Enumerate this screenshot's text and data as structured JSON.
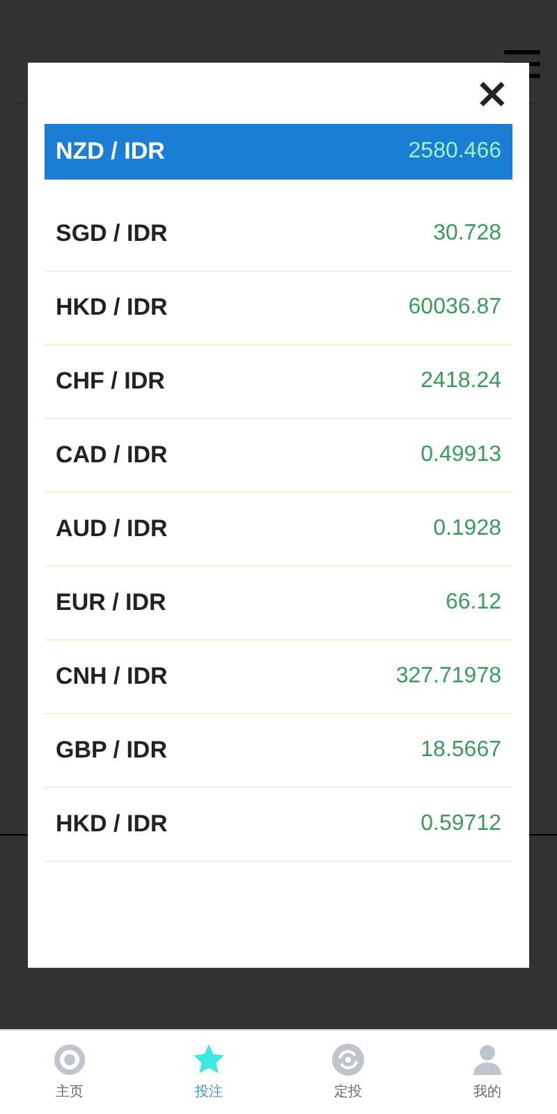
{
  "picker": {
    "close": "×",
    "rows": [
      {
        "pair": "NZD / IDR",
        "rate": "2580.466",
        "selected": true
      },
      {
        "pair": "SGD / IDR",
        "rate": "30.728",
        "selected": false
      },
      {
        "pair": "HKD / IDR",
        "rate": "60036.87",
        "selected": false
      },
      {
        "pair": "CHF / IDR",
        "rate": "2418.24",
        "selected": false
      },
      {
        "pair": "CAD / IDR",
        "rate": "0.49913",
        "selected": false
      },
      {
        "pair": "AUD / IDR",
        "rate": "0.1928",
        "selected": false
      },
      {
        "pair": "EUR / IDR",
        "rate": "66.12",
        "selected": false
      },
      {
        "pair": "CNH / IDR",
        "rate": "327.71978",
        "selected": false
      },
      {
        "pair": "GBP / IDR",
        "rate": "18.5667",
        "selected": false
      },
      {
        "pair": "HKD / IDR",
        "rate": "0.59712",
        "selected": false
      }
    ]
  },
  "nav": [
    {
      "kind": "home",
      "label": "主页",
      "selected": false
    },
    {
      "kind": "star",
      "label": "投注",
      "selected": true
    },
    {
      "kind": "cycle",
      "label": "定投",
      "selected": false
    },
    {
      "kind": "user",
      "label": "我的",
      "selected": false
    }
  ]
}
